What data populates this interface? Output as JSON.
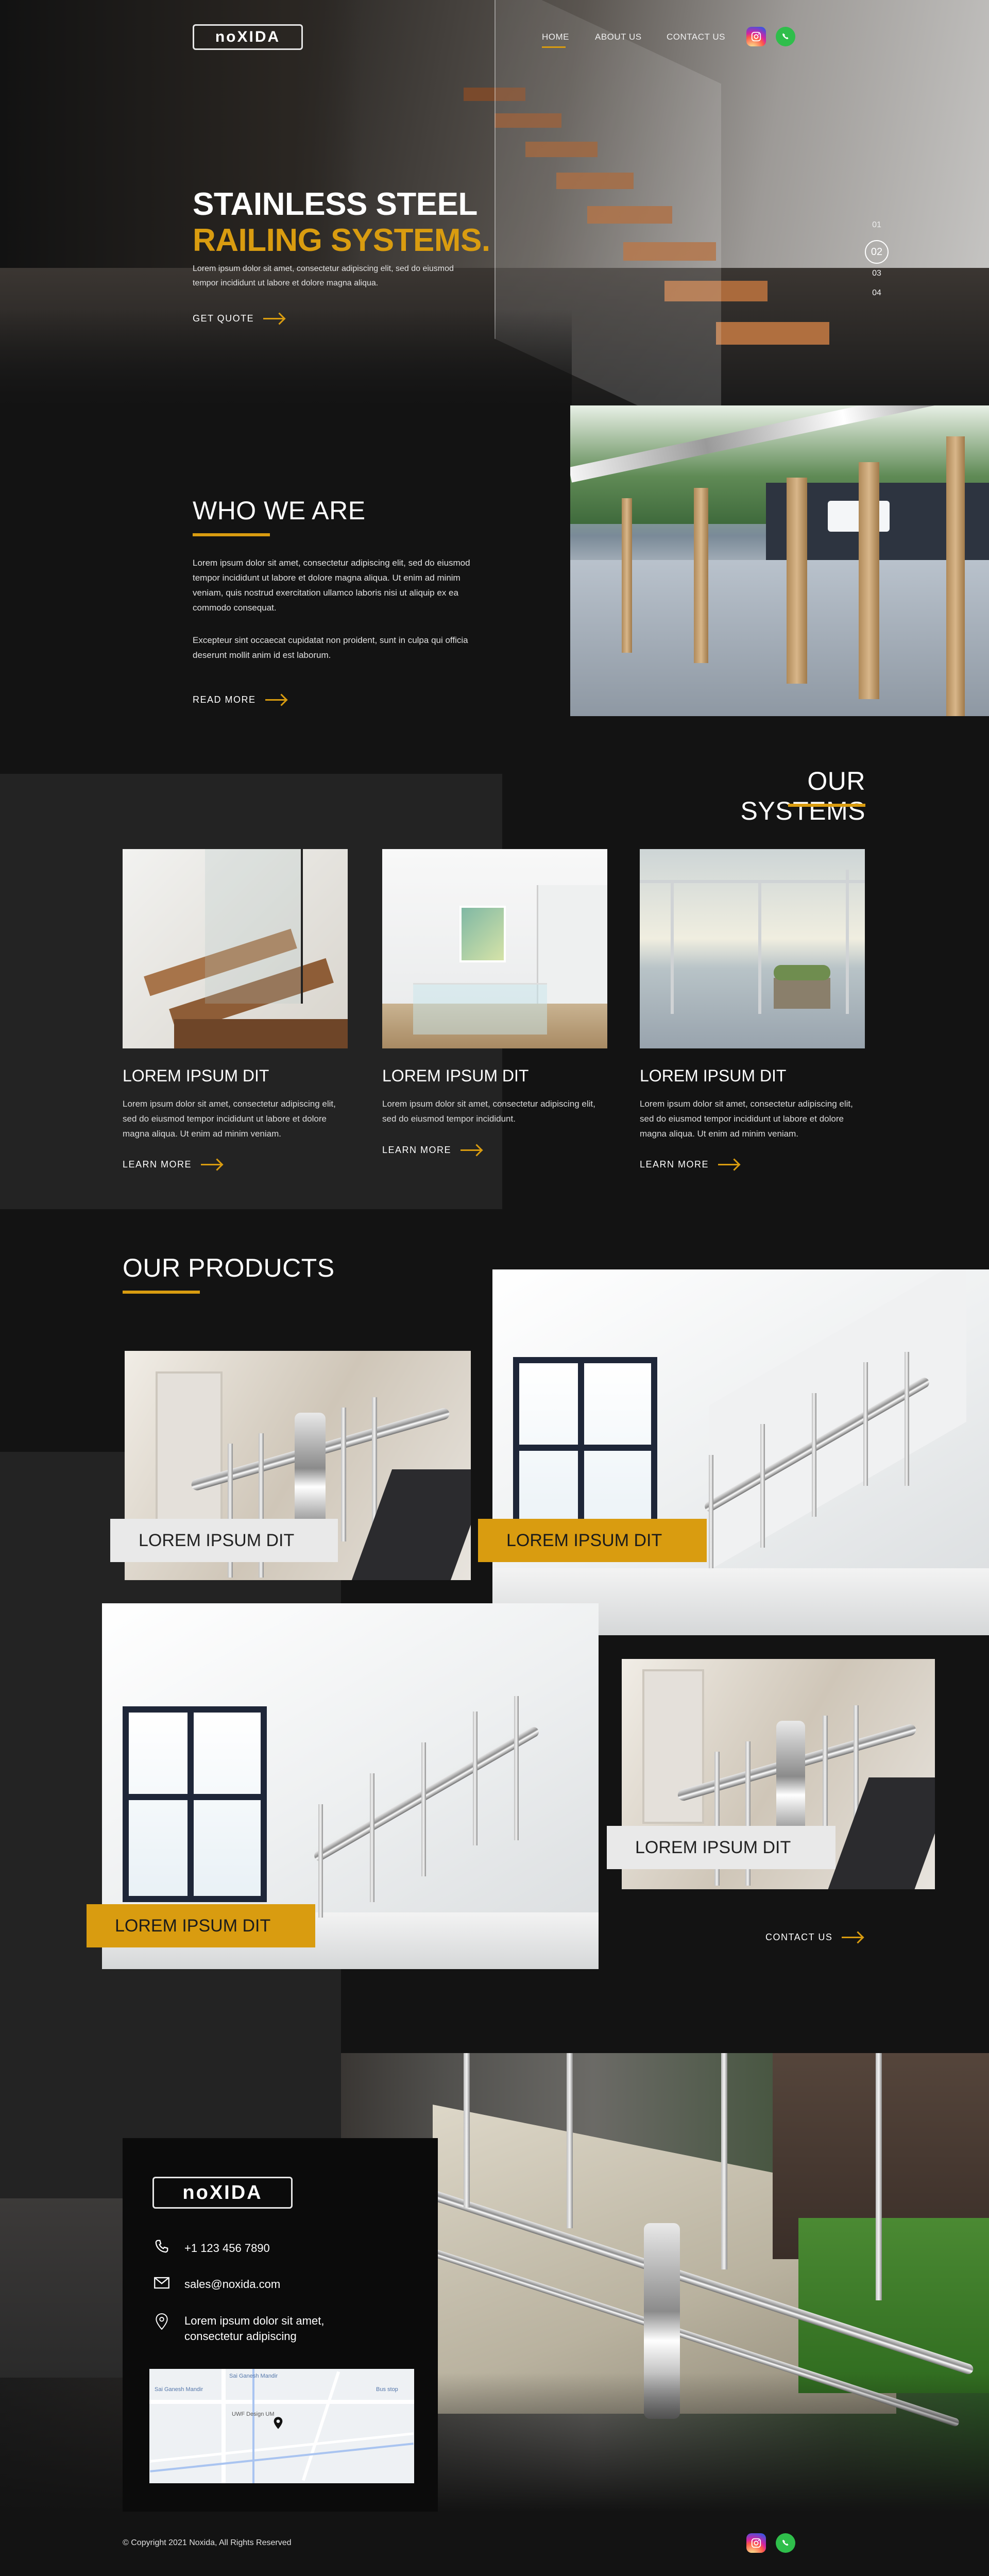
{
  "brand": {
    "logo_text": "noXIDA"
  },
  "nav": {
    "items": [
      {
        "label": "HOME"
      },
      {
        "label": "ABOUT US"
      },
      {
        "label": "CONTACT US"
      }
    ]
  },
  "hero": {
    "title_line1": "STAINLESS STEEL",
    "title_line2": "RAILING SYSTEMS.",
    "text": "Lorem ipsum dolor sit amet, consectetur adipiscing elit, sed do eiusmod tempor incididunt ut labore et dolore magna aliqua.",
    "cta": "GET QUOTE",
    "slides": [
      "01",
      "02",
      "03",
      "04"
    ],
    "active_slide": "02"
  },
  "about": {
    "title": "WHO WE ARE",
    "paragraph1": "Lorem ipsum dolor sit amet, consectetur adipiscing elit, sed do eiusmod tempor incididunt ut labore et dolore magna aliqua. Ut enim ad minim veniam, quis nostrud exercitation ullamco laboris nisi ut aliquip ex ea commodo consequat.",
    "paragraph2": "Excepteur sint occaecat cupidatat non proident, sunt in culpa qui officia deserunt mollit anim id est laborum.",
    "cta": "READ MORE"
  },
  "systems": {
    "title": "OUR SYSTEMS",
    "cards": [
      {
        "title": "LOREM IPSUM DIT",
        "text": "Lorem ipsum dolor sit amet, consectetur adipiscing elit, sed do eiusmod tempor incididunt ut labore et dolore magna aliqua. Ut enim ad minim veniam.",
        "cta": "LEARN MORE"
      },
      {
        "title": "LOREM IPSUM DIT",
        "text": "Lorem ipsum dolor sit amet, consectetur adipiscing elit, sed do eiusmod tempor incididunt.",
        "cta": "LEARN MORE"
      },
      {
        "title": "LOREM IPSUM DIT",
        "text": "Lorem ipsum dolor sit amet, consectetur adipiscing elit, sed do eiusmod tempor incididunt ut labore et dolore magna aliqua. Ut enim ad minim veniam.",
        "cta": "LEARN MORE"
      }
    ]
  },
  "products": {
    "title": "OUR PRODUCTS",
    "items": [
      {
        "label": "LOREM IPSUM DIT"
      },
      {
        "label": "LOREM IPSUM DIT"
      },
      {
        "label": "LOREM IPSUM DIT"
      },
      {
        "label": "LOREM IPSUM DIT"
      }
    ],
    "cta": "CONTACT US"
  },
  "contact": {
    "phone": "+1 123 456 7890",
    "email": "sales@noxida.com",
    "address": "Lorem ipsum dolor sit amet, consectetur adipiscing",
    "map_labels": [
      "Sai Ganesh Mandir",
      "Bus stop",
      "Sai Ganesh Mandir",
      "UWF Design UM"
    ]
  },
  "footer": {
    "copyright": "© Copyright 2021 Noxida, All Rights Reserved"
  },
  "colors": {
    "accent": "#d99c10",
    "background": "#131313",
    "panel": "#232323"
  },
  "icons": [
    "instagram-icon",
    "whatsapp-icon",
    "phone-icon",
    "mail-icon",
    "location-icon",
    "map-pin-icon"
  ]
}
